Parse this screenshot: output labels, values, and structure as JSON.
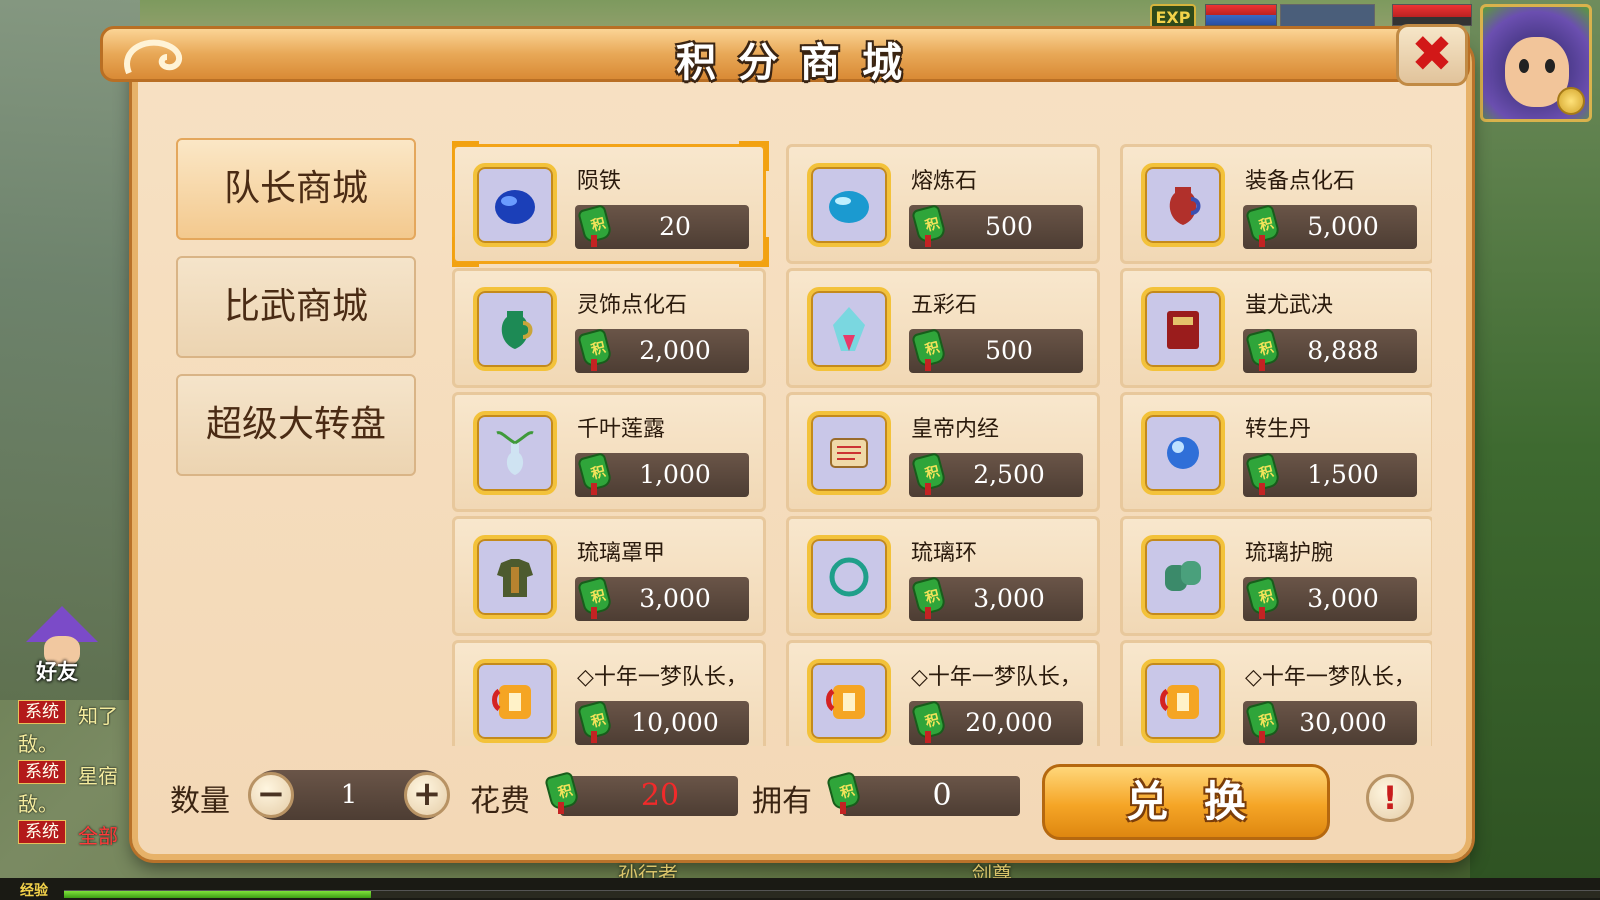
{
  "window": {
    "title": "积分商城",
    "close_symbol": "✖"
  },
  "hud": {
    "exp_badge": "EXP"
  },
  "tabs": [
    {
      "label": "队长商城",
      "active": true
    },
    {
      "label": "比武商城",
      "active": false
    },
    {
      "label": "超级大转盘",
      "active": false
    }
  ],
  "items": [
    {
      "name": "陨铁",
      "price": "20",
      "icon": "meteorite-icon",
      "selected": true
    },
    {
      "name": "熔炼石",
      "price": "500",
      "icon": "smelting-stone-icon"
    },
    {
      "name": "装备点化石",
      "price": "5,000",
      "icon": "equip-vase-icon"
    },
    {
      "name": "灵饰点化石",
      "price": "2,000",
      "icon": "jade-vase-icon"
    },
    {
      "name": "五彩石",
      "price": "500",
      "icon": "crystal-icon"
    },
    {
      "name": "蚩尤武决",
      "price": "8,888",
      "icon": "book-icon"
    },
    {
      "name": "千叶莲露",
      "price": "1,000",
      "icon": "lotus-vase-icon"
    },
    {
      "name": "皇帝内经",
      "price": "2,500",
      "icon": "scroll-book-icon"
    },
    {
      "name": "转生丹",
      "price": "1,500",
      "icon": "blue-orb-icon"
    },
    {
      "name": "琉璃罩甲",
      "price": "3,000",
      "icon": "armor-icon"
    },
    {
      "name": "琉璃环",
      "price": "3,000",
      "icon": "ring-icon"
    },
    {
      "name": "琉璃护腕",
      "price": "3,000",
      "icon": "bracer-icon"
    },
    {
      "name": "◇十年一梦队长，",
      "price": "10,000",
      "icon": "gift-scroll-icon"
    },
    {
      "name": "◇十年一梦队长，",
      "price": "20,000",
      "icon": "gift-scroll-icon"
    },
    {
      "name": "◇十年一梦队长，",
      "price": "30,000",
      "icon": "gift-scroll-icon"
    }
  ],
  "controls": {
    "quantity_label": "数量",
    "quantity_value": "1",
    "minus_symbol": "−",
    "plus_symbol": "+",
    "cost_label": "花费",
    "cost_value": "20",
    "own_label": "拥有",
    "own_value": "0",
    "exchange_label": "兑换",
    "info_symbol": "!"
  },
  "sidebar": {
    "friend_label": "好友",
    "chat": [
      {
        "tag": "系统",
        "text": "知了",
        "cont": "敌。",
        "color": "#f4ec9e"
      },
      {
        "tag": "系统",
        "text": "星宿",
        "cont": "敌。",
        "color": "#f4ec9e"
      },
      {
        "tag": "系统",
        "text": "全部",
        "cont": "",
        "color": "#ff3b3b"
      }
    ]
  },
  "bottom": {
    "exp_label": "经验",
    "exp_fraction": 0.2,
    "name_left": "孙行者",
    "name_right": "剑尊"
  },
  "colors": {
    "accent": "#e7b269",
    "coin": "#2fa53a",
    "cost_red": "#f12a2a"
  }
}
